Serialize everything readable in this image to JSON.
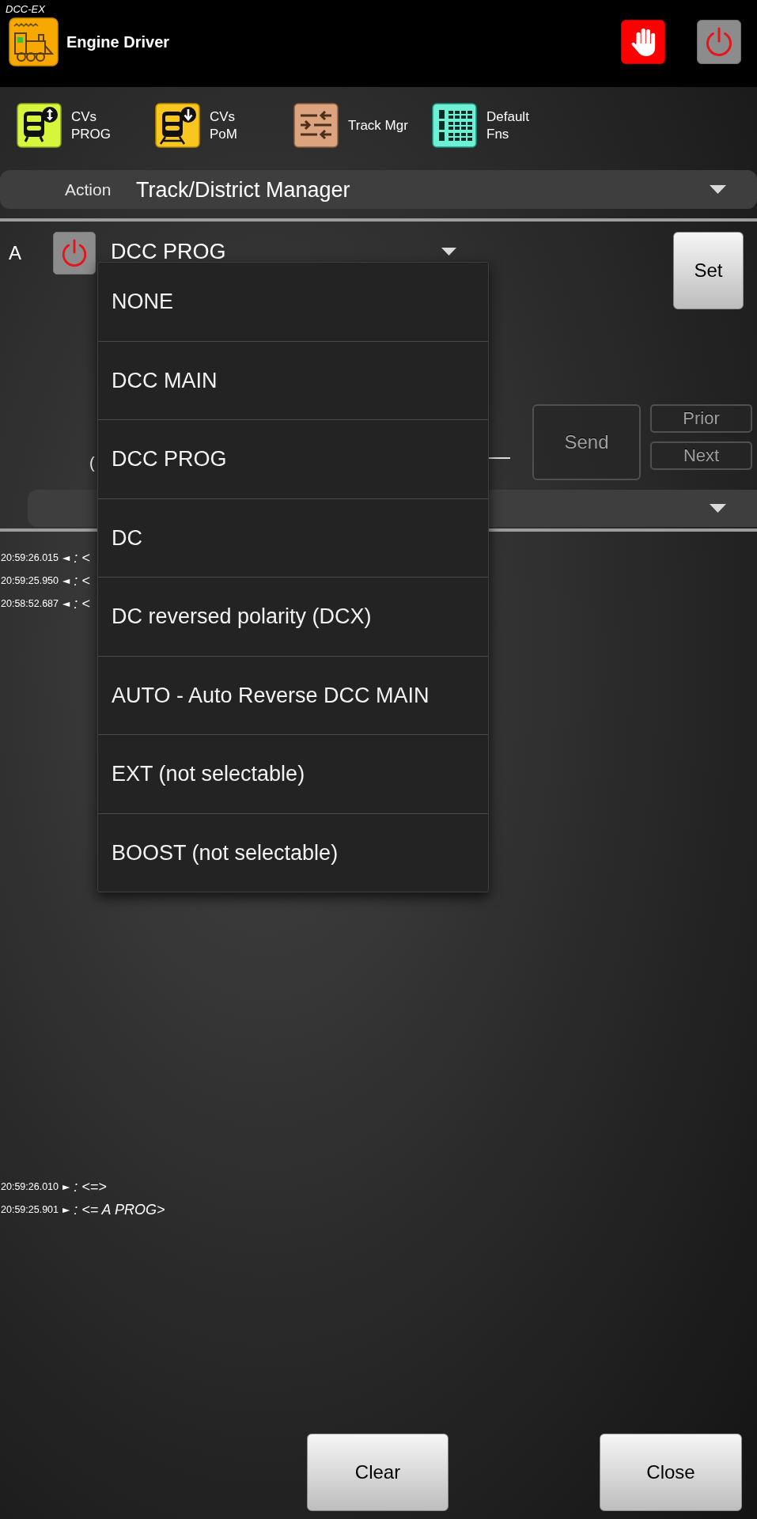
{
  "header": {
    "brand": "DCC-EX",
    "title": "Engine Driver"
  },
  "toolbar": [
    {
      "kind": "cv_prog",
      "lines": [
        "CVs",
        "PROG"
      ]
    },
    {
      "kind": "cv_pom",
      "lines": [
        "CVs",
        "PoM"
      ]
    },
    {
      "kind": "track_manager",
      "lines": [
        "Track Mgr"
      ]
    },
    {
      "kind": "default_functions",
      "lines": [
        "Default",
        "Fns"
      ]
    }
  ],
  "action": {
    "label": "Action",
    "value": "Track/District Manager"
  },
  "track": {
    "letter": "A",
    "mode": "DCC PROG",
    "set_button": "Set"
  },
  "cv_entry": {
    "label_fragment": "(",
    "send_button": {
      "label": "Send",
      "disabled": true
    },
    "prior_button": {
      "label": "Prior",
      "disabled": true
    },
    "next_button": {
      "label": "Next",
      "disabled": true
    }
  },
  "mode_menu": {
    "items": [
      "NONE",
      "DCC MAIN",
      "DCC PROG",
      "DC",
      "DC reversed polarity (DCX)",
      "AUTO - Auto Reverse DCC MAIN",
      "EXT (not selectable)",
      "BOOST (not selectable)"
    ]
  },
  "log_upper": [
    {
      "time": "20:59:26.015",
      "arrow": "◄",
      "message": ": <"
    },
    {
      "time": "20:59:25.950",
      "arrow": "◄",
      "message": ": <"
    },
    {
      "time": "20:58:52.687",
      "arrow": "◄",
      "message": ": <"
    }
  ],
  "log_lower": [
    {
      "time": "20:59:26.010",
      "arrow": "►",
      "message": ": <=>"
    },
    {
      "time": "20:59:25.901",
      "arrow": "►",
      "message": ": <= A PROG>"
    }
  ],
  "buttons": [
    "Clear",
    "Close"
  ]
}
